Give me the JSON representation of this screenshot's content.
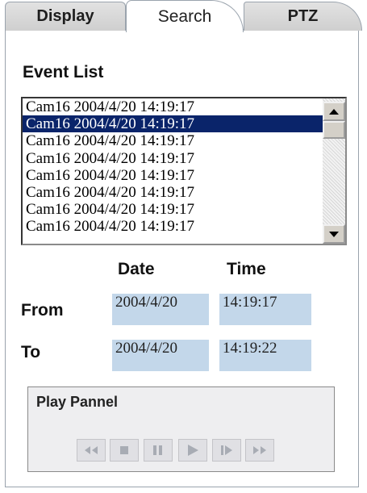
{
  "tabs": [
    {
      "label": "Display"
    },
    {
      "label": "Search"
    },
    {
      "label": "PTZ"
    }
  ],
  "event_list": {
    "title": "Event List",
    "items": [
      "Cam16 2004/4/20 14:19:17",
      "Cam16 2004/4/20 14:19:17",
      "Cam16 2004/4/20 14:19:17",
      "Cam16 2004/4/20 14:19:17",
      "Cam16 2004/4/20 14:19:17",
      "Cam16 2004/4/20 14:19:17",
      "Cam16 2004/4/20 14:19:17",
      "Cam16 2004/4/20 14:19:17"
    ],
    "selected_index": 1
  },
  "range": {
    "date_header": "Date",
    "time_header": "Time",
    "from_label": "From",
    "to_label": "To",
    "from_date": "2004/4/20",
    "from_time": "14:19:17",
    "to_date": "2004/4/20",
    "to_time": "14:19:22"
  },
  "play_panel": {
    "title": "Play Pannel",
    "controls": [
      "rewind-icon",
      "stop-icon",
      "pause-icon",
      "play-icon",
      "step-forward-icon",
      "fast-forward-icon"
    ]
  },
  "colors": {
    "selection": "#0a246a",
    "field_background": "#c3d7ea"
  }
}
